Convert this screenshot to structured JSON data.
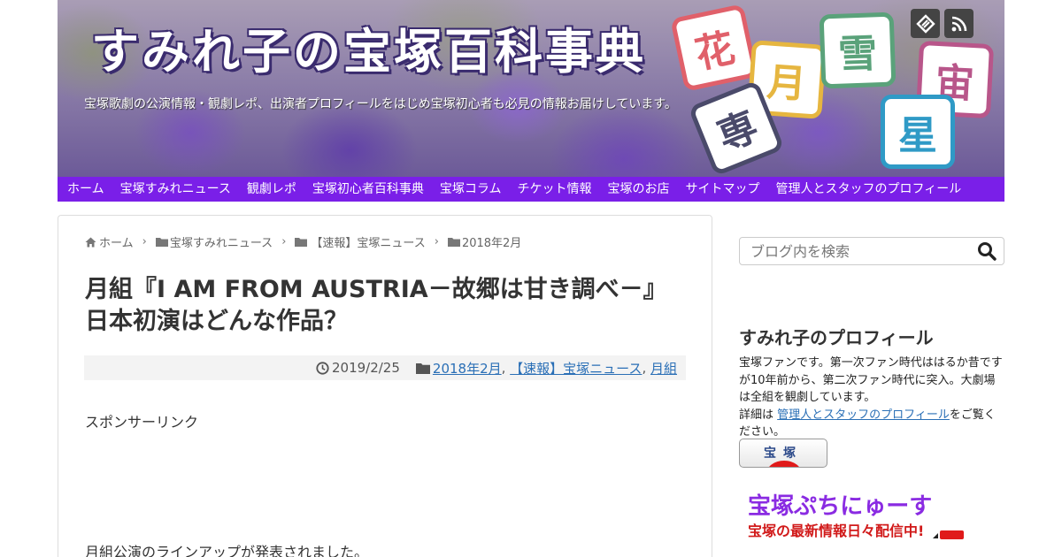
{
  "header": {
    "site_title": "すみれ子の宝塚百科事典",
    "description": "宝塚歌劇の公演情報・観劇レポ、出演者プロフィールをはじめ宝塚初心者も必見の情報お届けしています。",
    "stamps": [
      "花",
      "月",
      "雪",
      "宙",
      "星",
      "専"
    ],
    "sns": [
      {
        "name": "feedly",
        "icon": "feedly-icon"
      },
      {
        "name": "rss",
        "icon": "rss-icon"
      }
    ]
  },
  "nav": {
    "items": [
      "ホーム",
      "宝塚すみれニュース",
      "観劇レポ",
      "宝塚初心者百科事典",
      "宝塚コラム",
      "チケット情報",
      "宝塚のお店",
      "サイトマップ",
      "管理人とスタッフのプロフィール"
    ]
  },
  "breadcrumb": {
    "home": "ホーム",
    "items": [
      "宝塚すみれニュース",
      "【速報】宝塚ニュース",
      "2018年2月"
    ]
  },
  "article": {
    "title": "月組『I AM FROM AUSTRIA－故郷は甘き調べ－』日本初演はどんな作品？",
    "date": "2019/2/25",
    "categories": [
      "2018年2月",
      "【速報】宝塚ニュース",
      "月組"
    ],
    "sponsor_label": "スポンサーリンク",
    "body_first_line": "月組公演のラインアップが発表されました。"
  },
  "sidebar": {
    "search_placeholder": "ブログ内を検索",
    "profile_title": "すみれ子のプロフィール",
    "profile_text": "宝塚ファンです。第一次ファン時代ははるか昔ですが10年前から、第二次ファン時代に突入。大劇場は全組を観劇しています。",
    "profile_detail_prefix": "詳細は",
    "profile_link": "管理人とスタッフのプロフィール",
    "profile_detail_suffix": "をご覧ください。",
    "badge_label": "宝塚",
    "petit_title": "宝塚ぷちにゅーす",
    "petit_subtitle": "宝塚の最新情報日々配信中!"
  },
  "colors": {
    "nav_bg": "#7a1fe8",
    "link": "#2a6fb6",
    "petit_title": "#8a2be2",
    "petit_subtitle": "#d11a1a"
  }
}
